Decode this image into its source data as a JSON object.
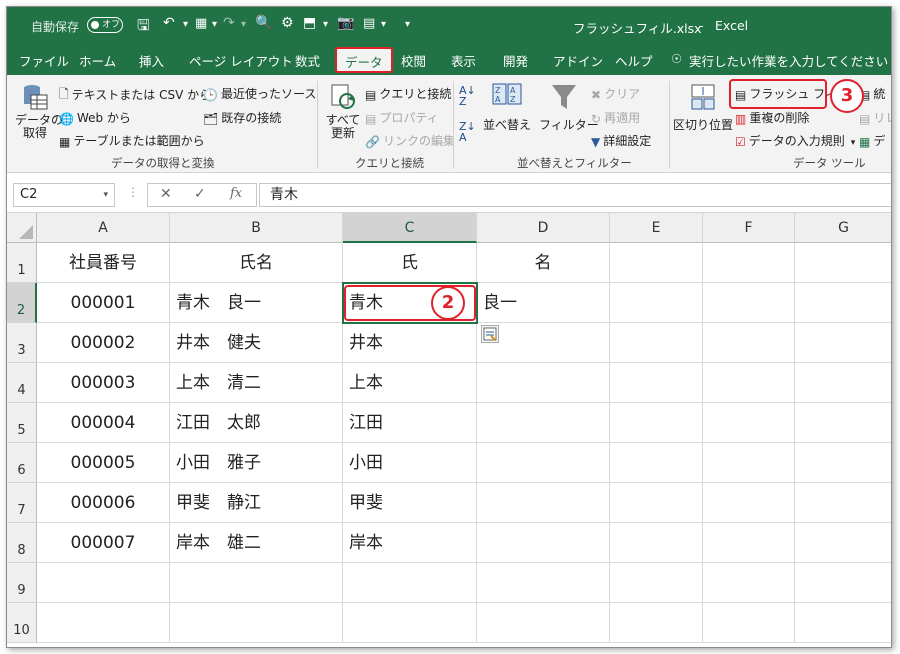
{
  "titlebar": {
    "autosave_label": "自動保存",
    "autosave_state": "オフ",
    "file_title": "フラッシュフィル.xlsx",
    "separator": "-",
    "app_name": "Excel",
    "colors": {
      "brand": "#217346",
      "highlight": "#e0202a"
    }
  },
  "tabs": [
    {
      "label": "ファイル"
    },
    {
      "label": "ホーム"
    },
    {
      "label": "挿入"
    },
    {
      "label": "ページ レイアウト"
    },
    {
      "label": "数式"
    },
    {
      "label": "データ"
    },
    {
      "label": "校閲"
    },
    {
      "label": "表示"
    },
    {
      "label": "開発"
    },
    {
      "label": "アドイン"
    },
    {
      "label": "ヘルプ"
    }
  ],
  "tell_me": "実行したい作業を入力してください",
  "ribbon": {
    "get_data": {
      "line1": "データの",
      "line2": "取得"
    },
    "text_csv": "テキストまたは CSV から",
    "web": "Web から",
    "table_range": "テーブルまたは範囲から",
    "recent_sources": "最近使ったソース",
    "existing_conn": "既存の接続",
    "group_get": "データの取得と変換",
    "refresh_all": {
      "line1": "すべて",
      "line2": "更新"
    },
    "queries_conn": "クエリと接続",
    "properties": "プロパティ",
    "edit_links": "リンクの編集",
    "group_queries": "クエリと接続",
    "sort": "並べ替え",
    "filter": "フィルター",
    "clear": "クリア",
    "reapply": "再適用",
    "advanced": "詳細設定",
    "group_sort": "並べ替えとフィルター",
    "text_to_columns": "区切り位置",
    "flash_fill": "フラッシュ フィル",
    "remove_dup": "重複の削除",
    "validation": "データの入力規則",
    "group_tools": "データ ツール",
    "consolidate": "統",
    "relations": "リレ",
    "data_model": "デ"
  },
  "formula_bar": {
    "name_box": "C2",
    "fx": "fx",
    "content": "青木"
  },
  "annotations": {
    "step2": "2",
    "step3": "3"
  },
  "sheet": {
    "columns": [
      "A",
      "B",
      "C",
      "D",
      "E",
      "F",
      "G"
    ],
    "rows": [
      "1",
      "2",
      "3",
      "4",
      "5",
      "6",
      "7",
      "8",
      "9",
      "10"
    ],
    "data": [
      [
        "社員番号",
        "氏名",
        "氏",
        "名"
      ],
      [
        "000001",
        "青木　良一",
        "青木",
        "良一"
      ],
      [
        "000002",
        "井本　健夫",
        "井本",
        ""
      ],
      [
        "000003",
        "上本　清二",
        "上本",
        ""
      ],
      [
        "000004",
        "江田　太郎",
        "江田",
        ""
      ],
      [
        "000005",
        "小田　雅子",
        "小田",
        ""
      ],
      [
        "000006",
        "甲斐　静江",
        "甲斐",
        ""
      ],
      [
        "000007",
        "岸本　雄二",
        "岸本",
        ""
      ],
      [
        "",
        "",
        "",
        ""
      ],
      [
        "",
        "",
        "",
        ""
      ]
    ]
  }
}
